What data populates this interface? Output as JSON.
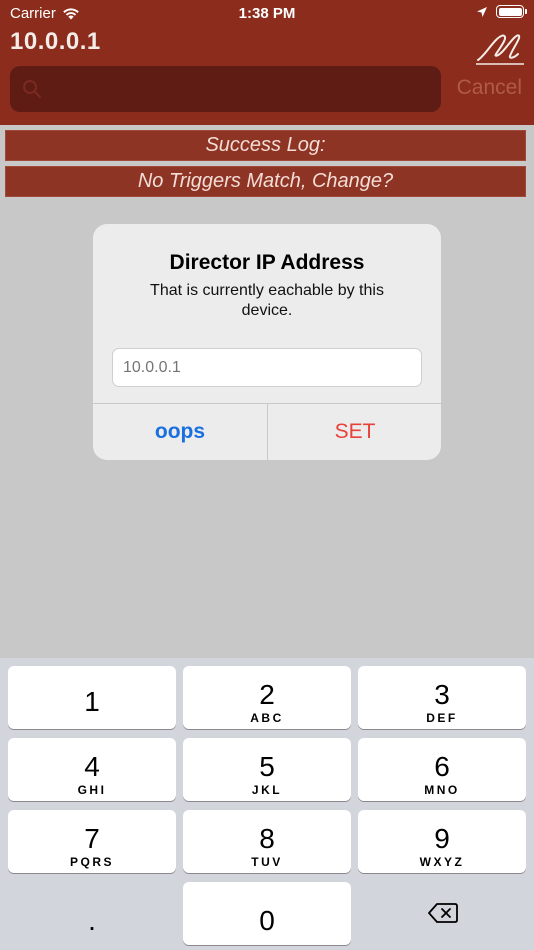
{
  "status_bar": {
    "carrier": "Carrier",
    "time": "1:38 PM"
  },
  "nav": {
    "title": "10.0.0.1",
    "search_placeholder": "",
    "cancel_label": "Cancel"
  },
  "log": {
    "success_label": "Success Log:",
    "no_match_label": "No Triggers Match, Change?"
  },
  "alert": {
    "title": "Director IP Address",
    "message": "That is currently eachable by this device.",
    "input_placeholder": "10.0.0.1",
    "input_value": "",
    "cancel_label": "oops",
    "confirm_label": "SET"
  },
  "keypad": {
    "keys": [
      {
        "num": "1",
        "letters": ""
      },
      {
        "num": "2",
        "letters": "ABC"
      },
      {
        "num": "3",
        "letters": "DEF"
      },
      {
        "num": "4",
        "letters": "GHI"
      },
      {
        "num": "5",
        "letters": "JKL"
      },
      {
        "num": "6",
        "letters": "MNO"
      },
      {
        "num": "7",
        "letters": "PQRS"
      },
      {
        "num": "8",
        "letters": "TUV"
      },
      {
        "num": "9",
        "letters": "WXYZ"
      },
      {
        "num": "0",
        "letters": ""
      }
    ],
    "dot_label": "."
  },
  "colors": {
    "header": "#8b2c1c",
    "accent_blue": "#1a6fe0",
    "accent_red": "#e8413a"
  },
  "icons": [
    "wifi-icon",
    "location-icon",
    "battery-icon",
    "signature-logo-icon",
    "search-icon",
    "delete-icon"
  ]
}
